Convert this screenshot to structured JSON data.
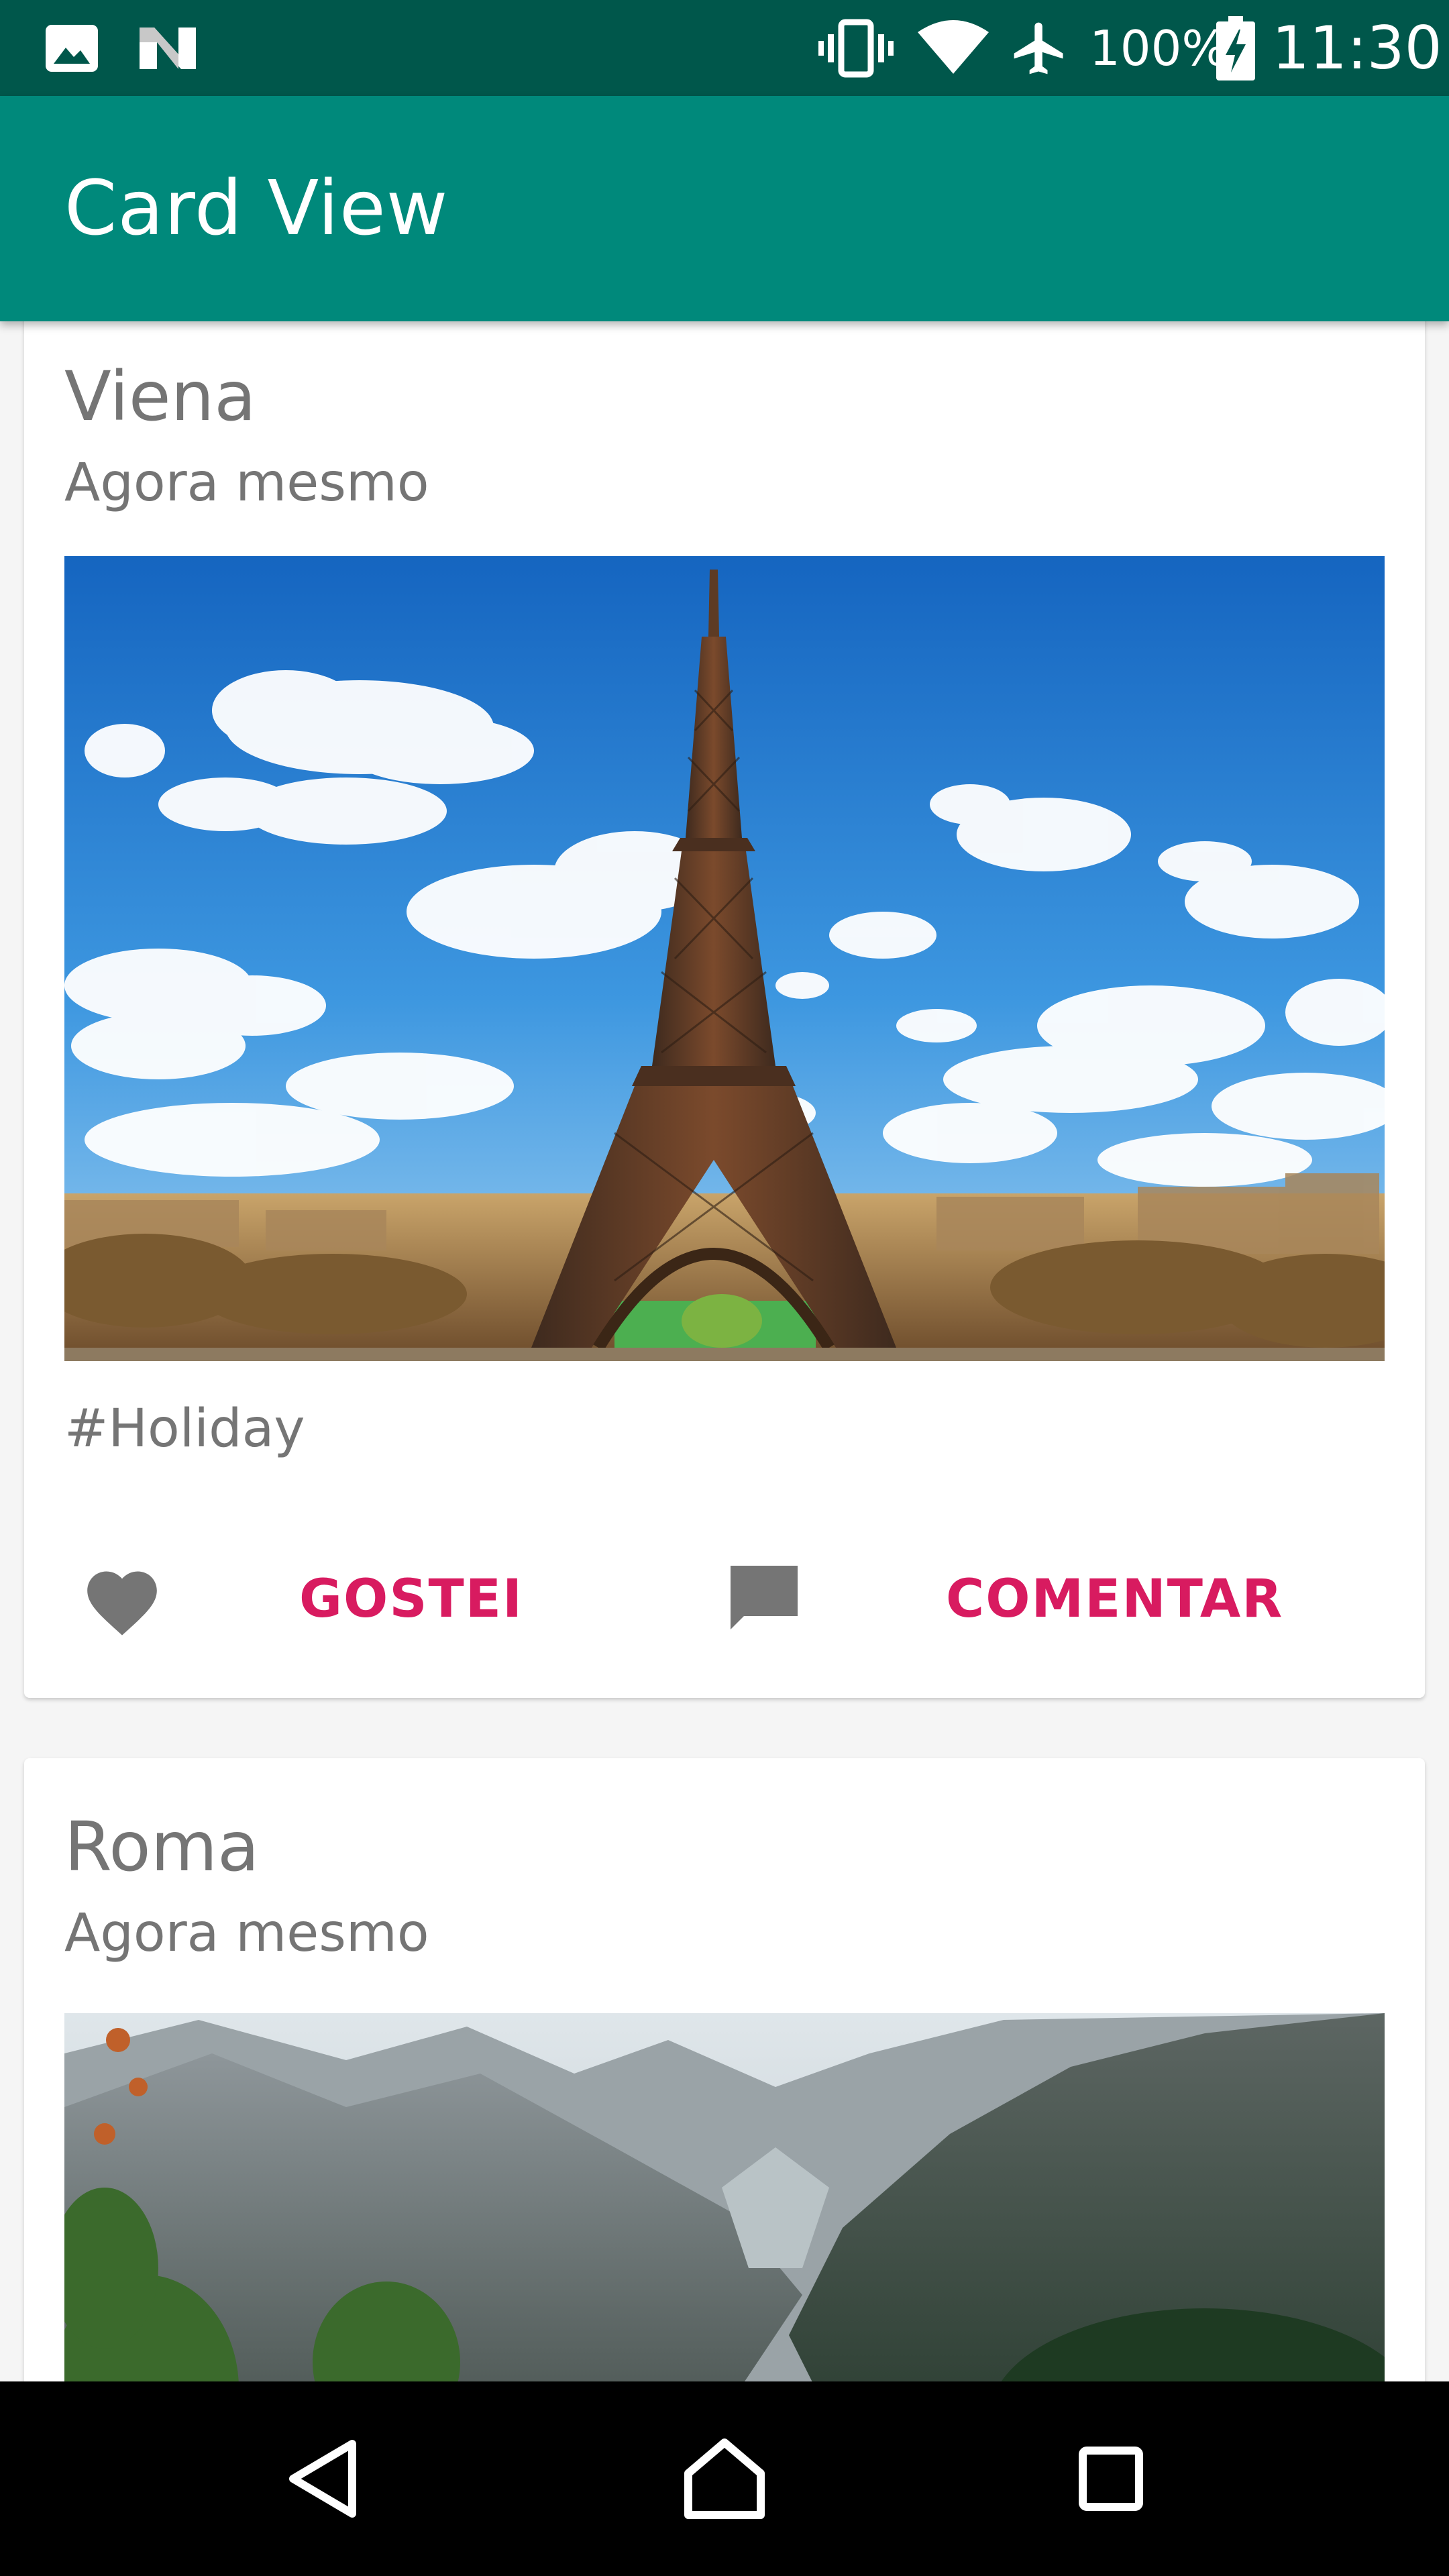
{
  "status_bar": {
    "battery_percent": "100%",
    "time": "11:30",
    "icons": [
      "image-icon",
      "n-logo-icon",
      "vibrate-icon",
      "wifi-icon",
      "airplane-icon",
      "battery-charging-icon"
    ]
  },
  "app_bar": {
    "title": "Card View"
  },
  "cards": [
    {
      "title": "Viena",
      "subtitle": "Agora mesmo",
      "image": "eiffel-tower-photo",
      "tag": "#Holiday",
      "like_label": "GOSTEI",
      "comment_label": "COMENTAR"
    },
    {
      "title": "Roma",
      "subtitle": "Agora mesmo",
      "image": "mountain-valley-photo"
    }
  ],
  "nav_bar": {
    "buttons": [
      "back-icon",
      "home-icon",
      "recents-icon"
    ]
  },
  "colors": {
    "status_bar": "#00574b",
    "app_bar": "#00897b",
    "accent": "#d81b60",
    "text_secondary": "#757575",
    "background": "#f5f5f5"
  }
}
